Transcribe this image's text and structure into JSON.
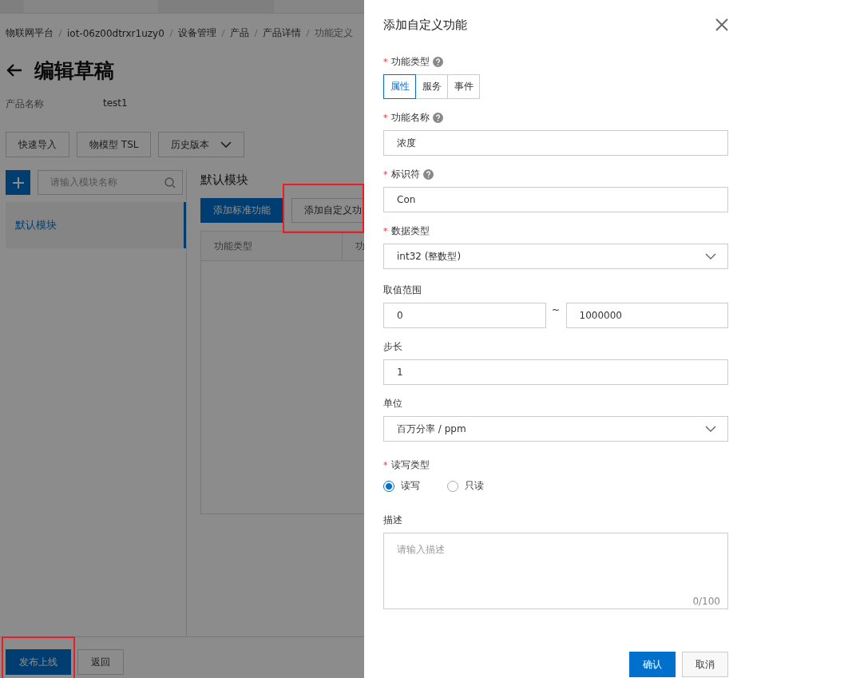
{
  "breadcrumb": [
    "物联网平台",
    "iot-06z00dtrxr1uzy0",
    "设备管理",
    "产品",
    "产品详情",
    "功能定义"
  ],
  "page_title": "编辑草稿",
  "product": {
    "label": "产品名称",
    "value": "test1"
  },
  "toolbar": [
    {
      "label": "快速导入",
      "kind": "plain"
    },
    {
      "label": "物模型 TSL",
      "kind": "plain"
    },
    {
      "label": "历史版本",
      "kind": "dropdown"
    }
  ],
  "module_search": {
    "placeholder": "请输入模块名称"
  },
  "modules": [
    {
      "label": "默认模块",
      "selected": true
    }
  ],
  "module_heading": "默认模块",
  "actions": [
    {
      "label": "添加标准功能",
      "kind": "primary"
    },
    {
      "label": "添加自定义功",
      "kind": "default"
    }
  ],
  "table": {
    "columns": [
      "功能类型",
      "功"
    ]
  },
  "footer_buttons": [
    {
      "label": "发布上线",
      "kind": "primary"
    },
    {
      "label": "返回",
      "kind": "default"
    }
  ],
  "drawer": {
    "title": "添加自定义功能",
    "fields": [
      {
        "kind": "segmented",
        "label": "功能类型",
        "required_mark": "*",
        "help": true,
        "options": [
          {
            "label": "属性",
            "selected": true
          },
          {
            "label": "服务",
            "selected": false
          },
          {
            "label": "事件",
            "selected": false
          }
        ]
      },
      {
        "kind": "text",
        "label": "功能名称",
        "required_mark": "*",
        "help": true,
        "value": "浓度"
      },
      {
        "kind": "text",
        "label": "标识符",
        "required_mark": "*",
        "help": true,
        "value": "Con"
      },
      {
        "kind": "select",
        "label": "数据类型",
        "required_mark": "*",
        "value": "int32 (整数型)"
      },
      {
        "kind": "range",
        "label": "取值范围",
        "min": "0",
        "separator": "~",
        "max": "1000000"
      },
      {
        "kind": "text",
        "label": "步长",
        "value": "1"
      },
      {
        "kind": "select",
        "label": "单位",
        "value": "百万分率 / ppm"
      },
      {
        "kind": "radio",
        "label": "读写类型",
        "required_mark": "*",
        "options": [
          {
            "label": "读写",
            "selected": true
          },
          {
            "label": "只读",
            "selected": false
          }
        ]
      },
      {
        "kind": "textarea",
        "label": "描述",
        "placeholder": "请输入描述",
        "counter": "0/100"
      }
    ],
    "buttons": [
      {
        "label": "确认",
        "kind": "primary"
      },
      {
        "label": "取消",
        "kind": "default"
      }
    ]
  }
}
